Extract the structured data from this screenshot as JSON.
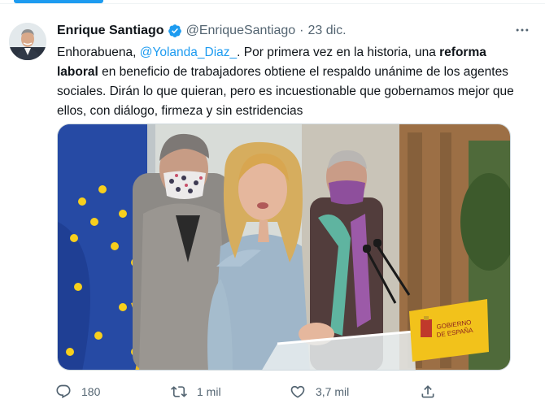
{
  "tweet": {
    "author_name": "Enrique Santiago",
    "handle": "@EnriqueSantiago",
    "separator": "·",
    "date": "23 dic.",
    "text_part1": "Enhorabuena, ",
    "mention": "@Yolanda_Diaz_",
    "text_part2": ". Por primera vez en la historia, una ",
    "text_bold": "reforma laboral",
    "text_part3": " en beneficio de trabajadores obtiene el respaldo unánime de los agentes sociales. Dirán lo que quieran, pero es incuestionable que gobernamos mejor que ellos, con diálogo, firmeza y sin estridencias"
  },
  "media": {
    "podium_sign_line1": "GOBIERNO",
    "podium_sign_line2": "DE ESPAÑA"
  },
  "actions": {
    "replies": "180",
    "retweets": "1 mil",
    "likes": "3,7 mil"
  },
  "colors": {
    "accent": "#1d9bf0",
    "secondary_text": "#536471",
    "eu_blue": "#1f3f94",
    "eu_star": "#f7cf1d"
  },
  "icons": [
    "verified-badge-icon",
    "more-icon",
    "reply-icon",
    "retweet-icon",
    "like-icon",
    "share-icon"
  ]
}
